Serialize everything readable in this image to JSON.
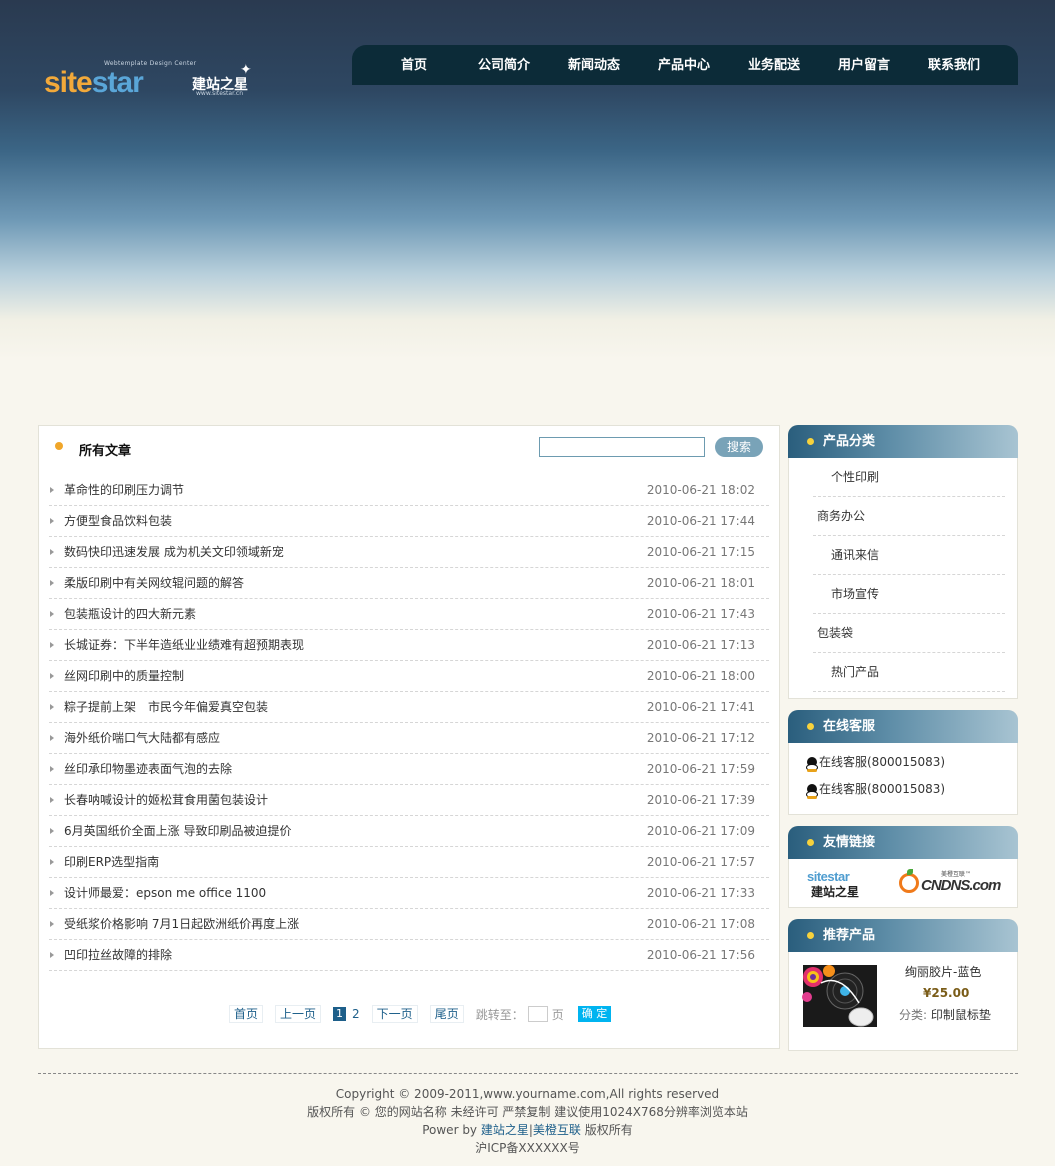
{
  "logo": {
    "tagline": "Webtemplate Design Center",
    "part1": "site",
    "part2": "star",
    "cn": "建站之星",
    "url": "www.sitestar.cn"
  },
  "nav": [
    "首页",
    "公司简介",
    "新闻动态",
    "产品中心",
    "业务配送",
    "用户留言",
    "联系我们"
  ],
  "main": {
    "title": "所有文章",
    "search_button": "搜索",
    "articles": [
      {
        "title": "革命性的印刷压力调节",
        "date": "2010-06-21 18:02"
      },
      {
        "title": "方便型食品饮料包装",
        "date": "2010-06-21 17:44"
      },
      {
        "title": "数码快印迅速发展 成为机关文印领域新宠",
        "date": "2010-06-21 17:15"
      },
      {
        "title": "柔版印刷中有关网纹辊问题的解答",
        "date": "2010-06-21 18:01"
      },
      {
        "title": "包装瓶设计的四大新元素",
        "date": "2010-06-21 17:43"
      },
      {
        "title": "长城证券：下半年造纸业业绩难有超预期表现",
        "date": "2010-06-21 17:13"
      },
      {
        "title": "丝网印刷中的质量控制",
        "date": "2010-06-21 18:00"
      },
      {
        "title": "粽子提前上架　市民今年偏爱真空包装",
        "date": "2010-06-21 17:41"
      },
      {
        "title": "海外纸价喘口气大陆都有感应",
        "date": "2010-06-21 17:12"
      },
      {
        "title": "丝印承印物墨迹表面气泡的去除",
        "date": "2010-06-21 17:59"
      },
      {
        "title": "长春呐喊设计的姬松茸食用菌包装设计",
        "date": "2010-06-21 17:39"
      },
      {
        "title": "6月英国纸价全面上涨 导致印刷品被迫提价",
        "date": "2010-06-21 17:09"
      },
      {
        "title": "印刷ERP选型指南",
        "date": "2010-06-21 17:57"
      },
      {
        "title": "设计师最爱：epson me office 1100",
        "date": "2010-06-21 17:33"
      },
      {
        "title": "受纸浆价格影响 7月1日起欧洲纸价再度上涨",
        "date": "2010-06-21 17:08"
      },
      {
        "title": "凹印拉丝故障的排除",
        "date": "2010-06-21 17:56"
      }
    ],
    "pagination": {
      "first": "首页",
      "prev": "上一页",
      "current": "1",
      "page2": "2",
      "next": "下一页",
      "last": "尾页",
      "jump_label": "跳转至：",
      "page_unit": "页",
      "go": "确 定"
    }
  },
  "sidebar": {
    "categories": {
      "title": "产品分类",
      "items": [
        "个性印刷",
        "商务办公",
        "通讯来信",
        "市场宣传",
        "包装袋",
        "热门产品"
      ]
    },
    "service": {
      "title": "在线客服",
      "items": [
        "在线客服(800015083)",
        "在线客服(800015083)"
      ]
    },
    "links": {
      "title": "友情链接",
      "sitestar_en": "sitestar",
      "sitestar_cn": "建站之星",
      "cndns": "CNDNS.com",
      "cndns_cn": "美橙互联™"
    },
    "product": {
      "title": "推荐产品",
      "name": "绚丽胶片-蓝色",
      "price": "¥25.00",
      "category_label": "分类:",
      "category": "印制鼠标垫"
    }
  },
  "footer": {
    "line1": "Copyright © 2009-2011,www.yourname.com,All rights reserved",
    "line2": "版权所有 © 您的网站名称 未经许可 严禁复制 建议使用1024X768分辨率浏览本站",
    "power_prefix": "Power by ",
    "power_link1": "建站之星",
    "power_sep": "|",
    "power_link2": "美橙互联",
    "power_suffix": " 版权所有",
    "icp": "沪ICP备XXXXXX号"
  }
}
